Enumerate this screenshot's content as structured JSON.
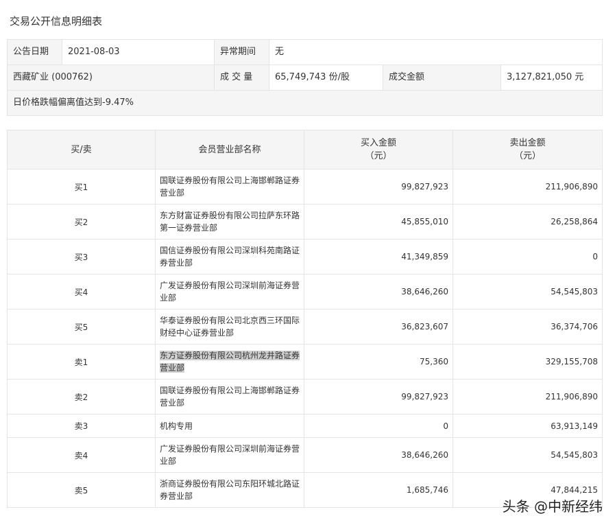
{
  "page": {
    "title": "交易公开信息明细表"
  },
  "summary": {
    "announce_date_label": "公告日期",
    "announce_date": "2021-08-03",
    "abnormal_period_label": "异常期间",
    "abnormal_period": "无",
    "stock": "西藏矿业 (000762)",
    "volume_label": "成 交 量",
    "volume": "65,749,743 份/股",
    "turnover_label": "成交金额",
    "turnover": "3,127,821,050 元",
    "note": "日价格跌幅偏离值达到-9.47%"
  },
  "detail": {
    "headers": {
      "side": "买/卖",
      "dept": "会员营业部名称",
      "buy_line1": "买入金额",
      "buy_line2": "（元）",
      "sell_line1": "卖出金额",
      "sell_line2": "（元）"
    },
    "rows": [
      {
        "side": "买1",
        "dept_l1": "国联证券股份有限公司上海邯郸路证券",
        "dept_l2": "营业部",
        "buy": "99,827,923",
        "sell": "211,906,890"
      },
      {
        "side": "买2",
        "dept_l1": "东方财富证券股份有限公司拉萨东环路",
        "dept_l2": "第一证券营业部",
        "buy": "45,855,010",
        "sell": "26,258,864"
      },
      {
        "side": "买3",
        "dept_l1": "国信证券股份有限公司深圳科苑南路证",
        "dept_l2": "券营业部",
        "buy": "41,349,859",
        "sell": "0"
      },
      {
        "side": "买4",
        "dept_l1": "广发证券股份有限公司深圳前海证券营",
        "dept_l2": "业部",
        "buy": "38,646,260",
        "sell": "54,545,803"
      },
      {
        "side": "买5",
        "dept_l1": "华泰证券股份有限公司北京西三环国际",
        "dept_l2": "财经中心证券营业部",
        "buy": "36,823,607",
        "sell": "36,374,706"
      },
      {
        "side": "卖1",
        "dept_l1": "东方证券股份有限公司杭州龙井路证券",
        "dept_l2": "营业部",
        "buy": "75,360",
        "sell": "329,155,708"
      },
      {
        "side": "卖2",
        "dept_l1": "国联证券股份有限公司上海邯郸路证券",
        "dept_l2": "营业部",
        "buy": "99,827,923",
        "sell": "211,906,890"
      },
      {
        "side": "卖3",
        "dept_l1": "机构专用",
        "dept_l2": "",
        "buy": "0",
        "sell": "63,913,149"
      },
      {
        "side": "卖4",
        "dept_l1": "广发证券股份有限公司深圳前海证券营",
        "dept_l2": "业部",
        "buy": "38,646,260",
        "sell": "54,545,803"
      },
      {
        "side": "卖5",
        "dept_l1": "浙商证券股份有限公司东阳环城北路证",
        "dept_l2": "券营业部",
        "buy": "1,685,746",
        "sell": "47,844,215"
      }
    ]
  },
  "watermark": "头条 @中新经纬",
  "colors": {
    "header_bg": "#f5f5f5",
    "border": "#e4e4e4",
    "text": "#333333",
    "selection": "#cfcfcf"
  }
}
